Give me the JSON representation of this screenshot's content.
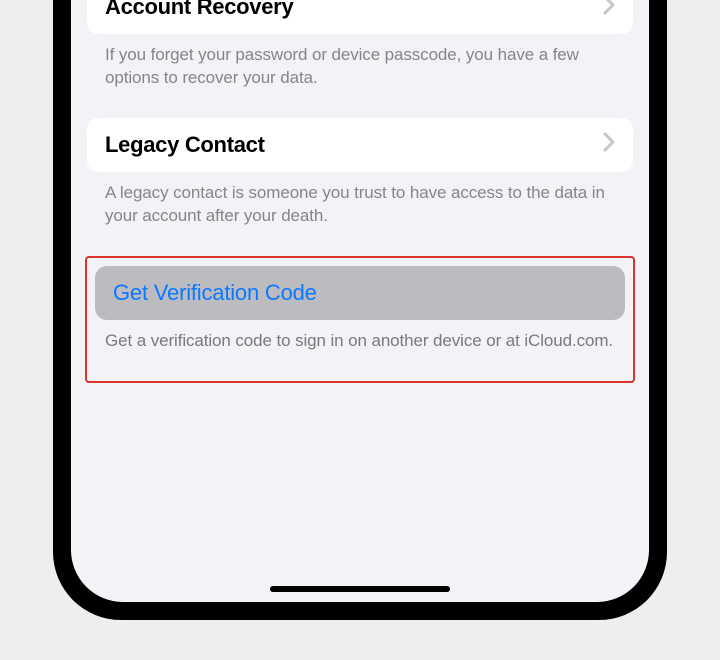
{
  "sections": {
    "accountRecovery": {
      "title": "Account Recovery",
      "footer": "If you forget your password or device passcode, you have a few options to recover your data."
    },
    "legacyContact": {
      "title": "Legacy Contact",
      "footer": "A legacy contact is someone you trust to have access to the data in your account after your death."
    },
    "verificationCode": {
      "title": "Get Verification Code",
      "footer": "Get a verification code to sign in on another device or at iCloud.com."
    }
  },
  "colors": {
    "link": "#0b78ff",
    "highlight": "#d9352c",
    "background": "#f2f2f7"
  }
}
